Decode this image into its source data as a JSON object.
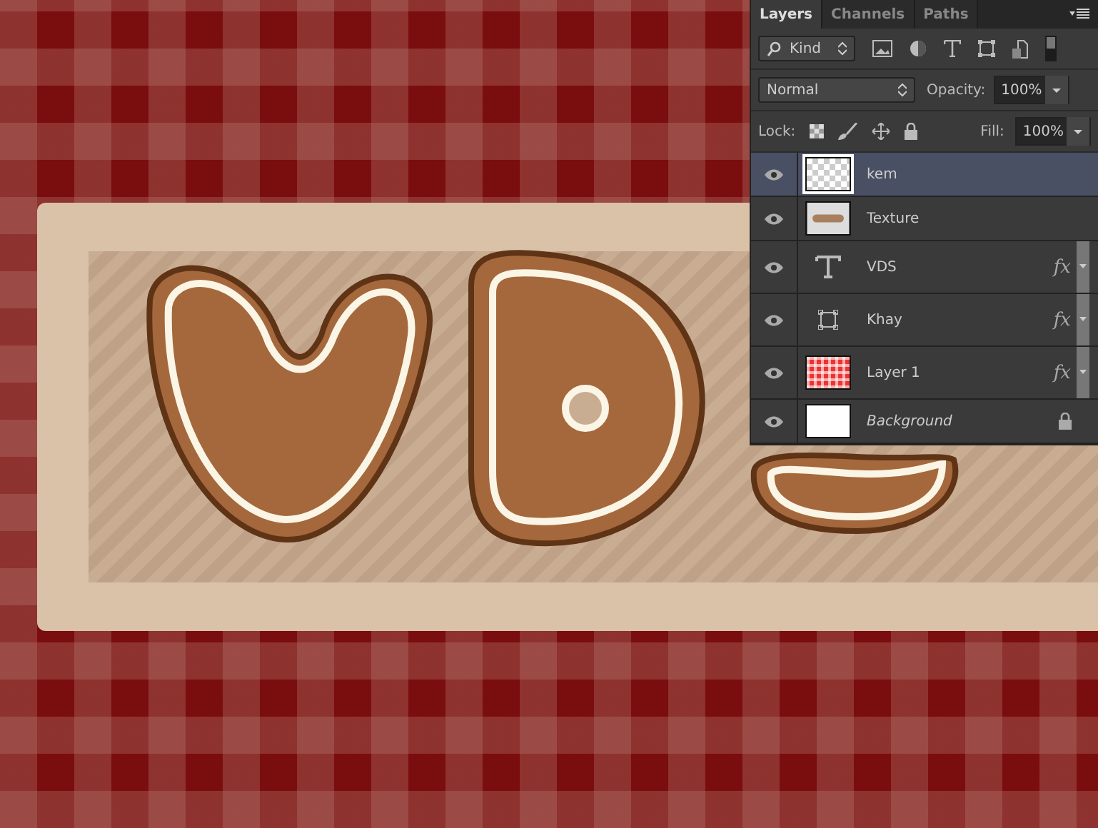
{
  "tabs": [
    {
      "label": "Layers",
      "selected": true
    },
    {
      "label": "Channels",
      "selected": false
    },
    {
      "label": "Paths",
      "selected": false
    }
  ],
  "filter": {
    "value": "Kind"
  },
  "blend_mode": {
    "value": "Normal"
  },
  "opacity": {
    "label": "Opacity:",
    "value": "100%"
  },
  "lock": {
    "label": "Lock:"
  },
  "fill": {
    "label": "Fill:",
    "value": "100%"
  },
  "layers": [
    {
      "name": "kem",
      "kind": "transparent",
      "selected": true,
      "visible": true,
      "locked": false
    },
    {
      "name": "Texture",
      "kind": "texture",
      "selected": false,
      "visible": true,
      "locked": false
    },
    {
      "name": "VDS",
      "kind": "text",
      "selected": false,
      "visible": true,
      "fx": "fx",
      "locked": false
    },
    {
      "name": "Khay",
      "kind": "shape",
      "selected": false,
      "visible": true,
      "fx": "fx",
      "locked": false
    },
    {
      "name": "Layer 1",
      "kind": "pattern",
      "selected": false,
      "visible": true,
      "fx": "fx",
      "locked": false
    },
    {
      "name": "Background",
      "kind": "background",
      "selected": false,
      "visible": true,
      "locked": true
    }
  ]
}
